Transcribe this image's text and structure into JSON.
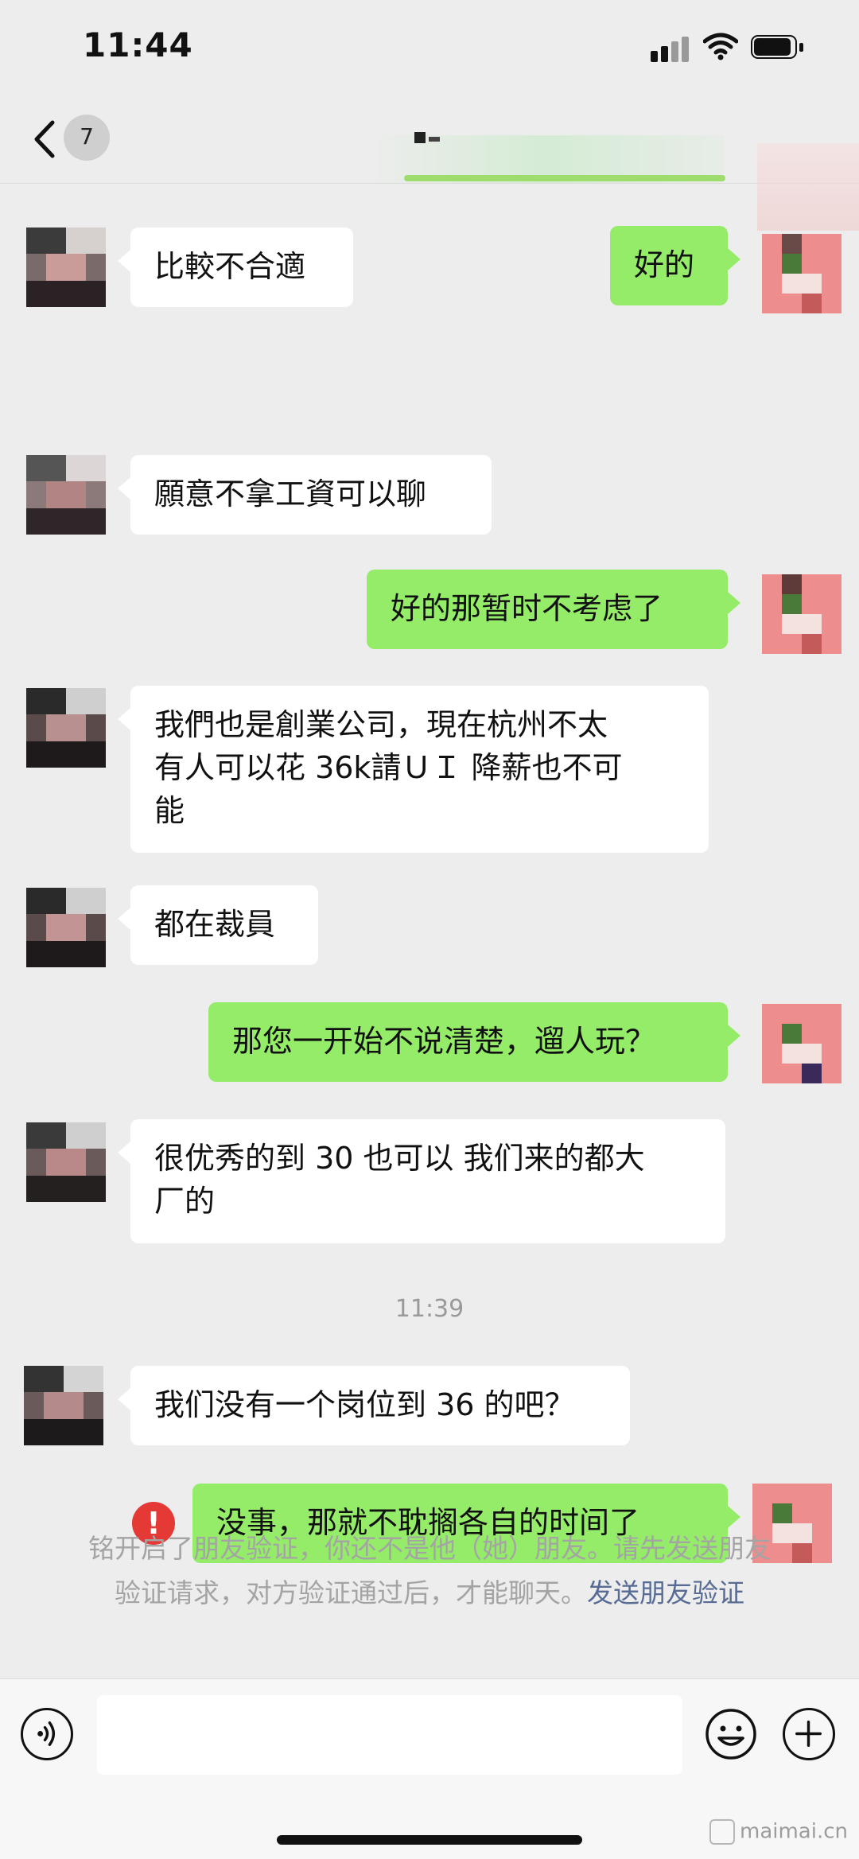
{
  "status_bar": {
    "time": "11:44"
  },
  "nav": {
    "unread_count": "7"
  },
  "messages": [
    {
      "side": "in",
      "text": "比較不合適"
    },
    {
      "side": "out",
      "text": "好的"
    },
    {
      "side": "in",
      "text": "願意不拿工資可以聊"
    },
    {
      "side": "out",
      "text": "好的那暂时不考虑了"
    },
    {
      "side": "in",
      "lines": [
        "我們也是創業公司，現在杭州不太",
        "有人可以花 36k請ＵＩ 降薪也不可",
        "能"
      ]
    },
    {
      "side": "in",
      "text": "都在裁員"
    },
    {
      "side": "out",
      "text": "那您一开始不说清楚，遛人玩？"
    },
    {
      "side": "in",
      "lines": [
        "很优秀的到 30 也可以 我们来的都大",
        "厂的"
      ]
    },
    {
      "side": "in",
      "text": "我们没有一个岗位到 36 的吧？"
    },
    {
      "side": "out",
      "text": "没事，那就不耽搁各自的时间了",
      "failed": true
    }
  ],
  "timestamp": "11:39",
  "error_icon_text": "!",
  "system_notice": {
    "line1": "铭开启了朋友验证，你还不是他（她）朋友。请先发送朋友",
    "line2": "验证请求，对方验证通过后，才能聊天。",
    "link": "发送朋友验证"
  },
  "watermark": "maimai.cn"
}
